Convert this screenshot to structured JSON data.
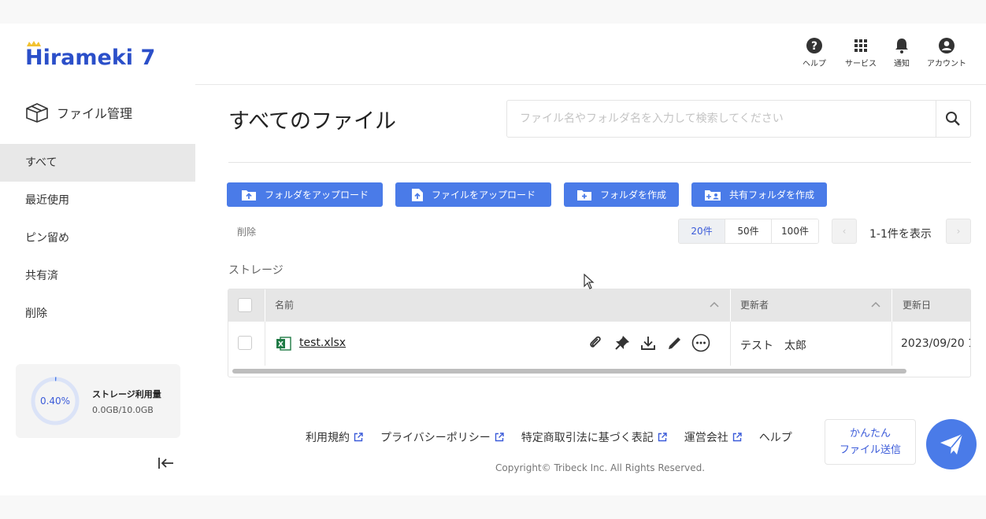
{
  "app": {
    "logo_text": "Hirameki 7",
    "logo_rest": "irameki 7",
    "logo_h": "H"
  },
  "sidebar": {
    "section_title": "ファイル管理",
    "items": [
      {
        "label": "すべて",
        "active": true
      },
      {
        "label": "最近使用",
        "active": false
      },
      {
        "label": "ピン留め",
        "active": false
      },
      {
        "label": "共有済",
        "active": false
      },
      {
        "label": "削除",
        "active": false
      }
    ],
    "storage": {
      "percent_label": "0.40%",
      "percent": 0.4,
      "label": "ストレージ利用量",
      "value": "0.0GB/10.0GB"
    },
    "collapse_icon": "collapse-left-icon"
  },
  "header": {
    "buttons": [
      {
        "label": "ヘルプ",
        "icon": "help-icon"
      },
      {
        "label": "サービス",
        "icon": "grid-icon"
      },
      {
        "label": "通知",
        "icon": "bell-icon"
      },
      {
        "label": "アカウント",
        "icon": "account-icon"
      }
    ]
  },
  "main": {
    "title": "すべてのファイル",
    "search": {
      "placeholder": "ファイル名やフォルダ名を入力して検索してください",
      "value": ""
    },
    "actions": [
      {
        "label": "フォルダをアップロード",
        "icon": "folder-upload-icon"
      },
      {
        "label": "ファイルをアップロード",
        "icon": "file-upload-icon"
      },
      {
        "label": "フォルダを作成",
        "icon": "folder-add-icon"
      },
      {
        "label": "共有フォルダを作成",
        "icon": "shared-folder-add-icon"
      }
    ],
    "delete_label": "削除",
    "page_sizes": [
      {
        "label": "20件",
        "active": true
      },
      {
        "label": "50件",
        "active": false
      },
      {
        "label": "100件",
        "active": false
      }
    ],
    "prev_label": "‹",
    "next_label": "›",
    "range_label": "1-1件を表示",
    "storage_heading": "ストレージ",
    "table": {
      "columns": [
        "名前",
        "更新者",
        "更新日"
      ],
      "rows": [
        {
          "name": "test.xlsx",
          "updater": "テスト　太郎",
          "updated": "2023/09/20 1"
        }
      ]
    }
  },
  "footer": {
    "links": [
      "利用規約",
      "プライバシーポリシー",
      "特定商取引法に基づく表記",
      "運営会社",
      "ヘルプ"
    ],
    "copyright": "Copyright© Tribeck Inc. All Rights Reserved."
  },
  "send": {
    "line1": "かんたん",
    "line2": "ファイル送信"
  },
  "colors": {
    "accent": "#4a7be8",
    "brand": "#2b4fc9",
    "crown": "#f2c230"
  }
}
